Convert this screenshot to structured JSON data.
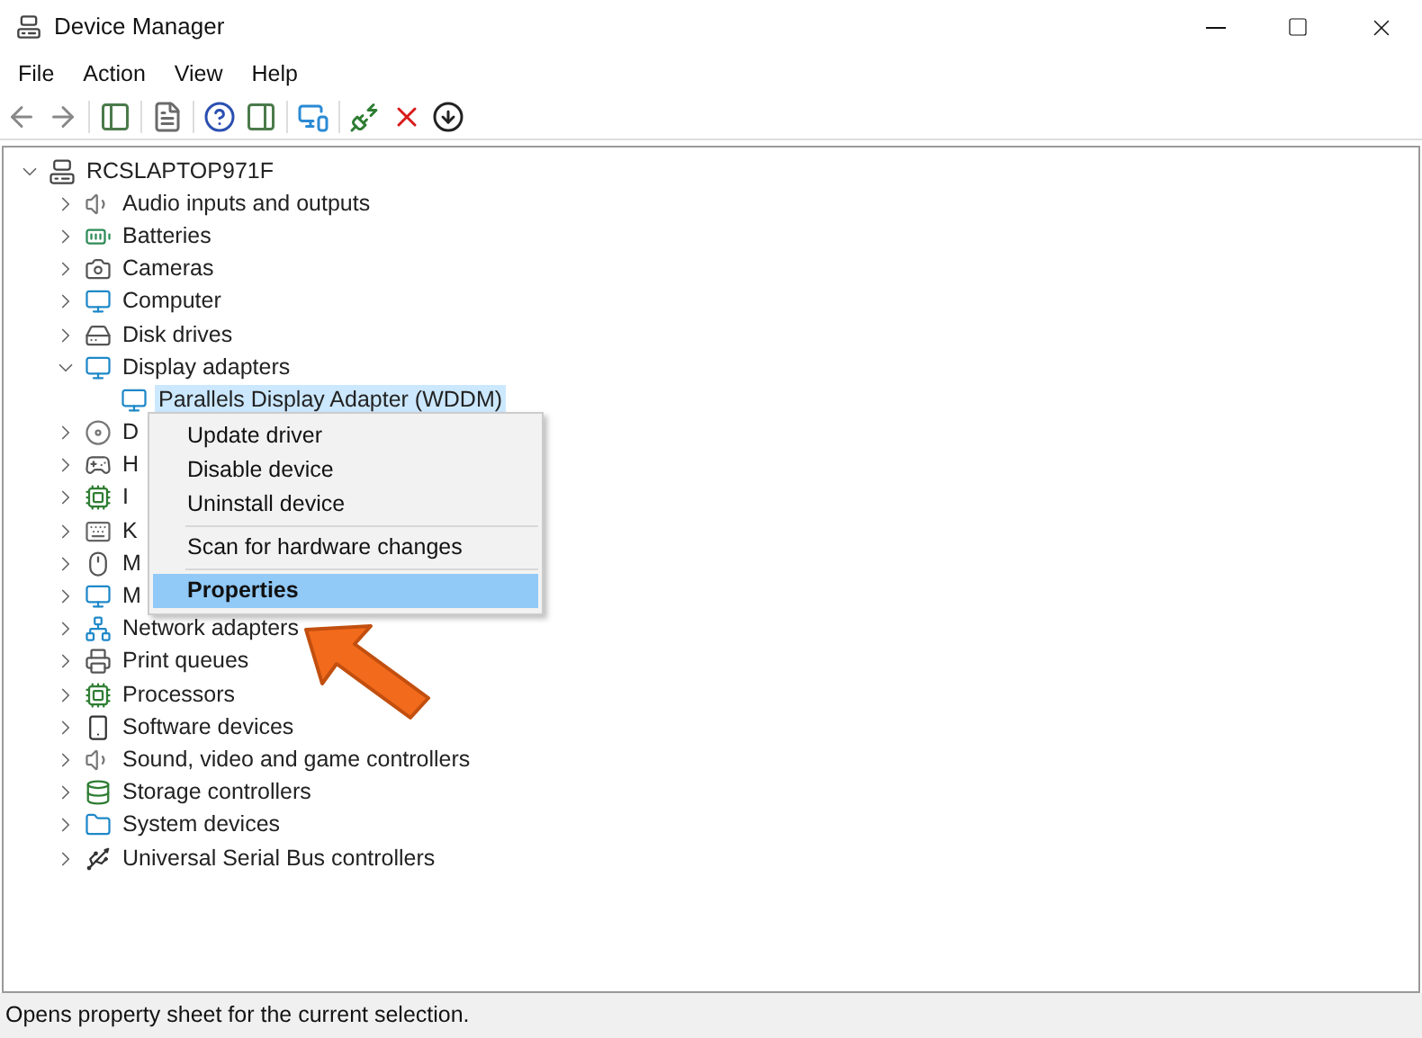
{
  "window": {
    "title": "Device Manager"
  },
  "menu_bar": [
    "File",
    "Action",
    "View",
    "Help"
  ],
  "tree": {
    "label": "RCSLAPTOP971F",
    "expanded": true,
    "children": [
      {
        "label": "Audio inputs and outputs",
        "expanded": false
      },
      {
        "label": "Batteries",
        "expanded": false
      },
      {
        "label": "Cameras",
        "expanded": false
      },
      {
        "label": "Computer",
        "expanded": false
      },
      {
        "label": "Disk drives",
        "expanded": false
      },
      {
        "label": "Display adapters",
        "expanded": true,
        "children": [
          {
            "label": "Parallels Display Adapter (WDDM)",
            "selected": true
          }
        ]
      },
      {
        "label": "D",
        "expanded": false
      },
      {
        "label": "H",
        "expanded": false
      },
      {
        "label": "I",
        "expanded": false
      },
      {
        "label": "K",
        "expanded": false
      },
      {
        "label": "M",
        "expanded": false
      },
      {
        "label": "M",
        "expanded": false
      },
      {
        "label": "Network adapters",
        "expanded": false
      },
      {
        "label": "Print queues",
        "expanded": false
      },
      {
        "label": "Processors",
        "expanded": false
      },
      {
        "label": "Software devices",
        "expanded": false
      },
      {
        "label": "Sound, video and game controllers",
        "expanded": false
      },
      {
        "label": "Storage controllers",
        "expanded": false
      },
      {
        "label": "System devices",
        "expanded": false
      },
      {
        "label": "Universal Serial Bus controllers",
        "expanded": false
      }
    ]
  },
  "context_menu": [
    {
      "kind": "item",
      "label": "Update driver",
      "selected": false
    },
    {
      "kind": "item",
      "label": "Disable device",
      "selected": false
    },
    {
      "kind": "item",
      "label": "Uninstall device",
      "selected": false
    },
    {
      "kind": "separator"
    },
    {
      "kind": "item",
      "label": "Scan for hardware changes",
      "selected": false
    },
    {
      "kind": "separator"
    },
    {
      "kind": "item",
      "label": "Properties",
      "selected": true
    }
  ],
  "status_bar": "Opens property sheet for the current selection."
}
